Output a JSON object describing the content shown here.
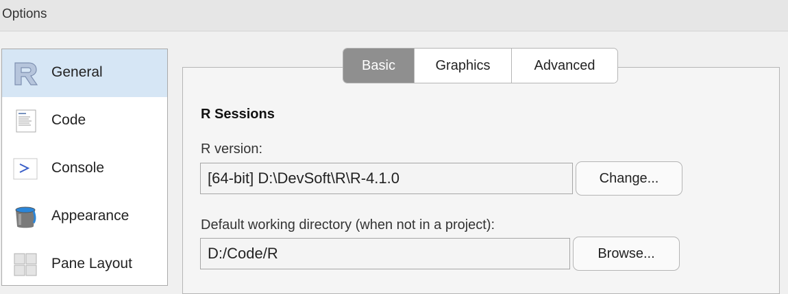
{
  "window": {
    "title": "Options"
  },
  "sidebar": {
    "items": [
      {
        "label": "General",
        "icon": "r-logo-icon",
        "selected": true
      },
      {
        "label": "Code",
        "icon": "code-document-icon",
        "selected": false
      },
      {
        "label": "Console",
        "icon": "console-prompt-icon",
        "selected": false
      },
      {
        "label": "Appearance",
        "icon": "paint-bucket-icon",
        "selected": false
      },
      {
        "label": "Pane Layout",
        "icon": "pane-layout-icon",
        "selected": false
      }
    ]
  },
  "tabs": [
    {
      "label": "Basic",
      "active": true
    },
    {
      "label": "Graphics",
      "active": false
    },
    {
      "label": "Advanced",
      "active": false
    }
  ],
  "r_sessions": {
    "title": "R Sessions",
    "r_version_label": "R version:",
    "r_version_value": "[64-bit] D:\\DevSoft\\R\\R-4.1.0",
    "change_button": "Change...",
    "working_dir_label": "Default working directory (when not in a project):",
    "working_dir_value": "D:/Code/R",
    "browse_button": "Browse..."
  },
  "colors": {
    "selected_sidebar_bg": "#d6e6f5",
    "active_tab_bg": "#8f8f8f",
    "titlebar_bg": "#e6e6e6"
  }
}
